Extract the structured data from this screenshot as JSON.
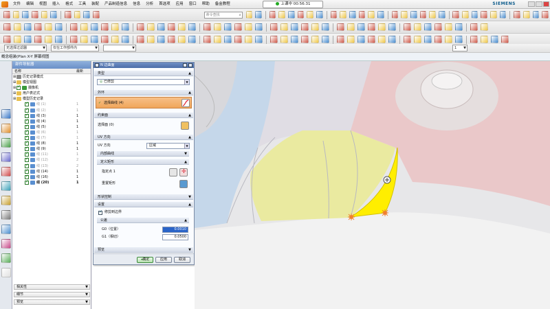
{
  "menu_bar": {
    "items": [
      "文件",
      "编辑",
      "视图",
      "插入",
      "格式",
      "工具",
      "装配",
      "产品制造信息",
      "信息",
      "分析",
      "首选项",
      "应用",
      "窗口",
      "帮助",
      "备金教程"
    ],
    "recording": "上课中 00:56:31",
    "brand": "SIEMENS"
  },
  "toolbar": {
    "command_search_placeholder": "命令查找",
    "filter_value": "无选择过滤器",
    "assembly_scope": "仅在工作部件内",
    "layer_value": "1"
  },
  "view_title": "概念组装(Plan X-Y 屏幕视图",
  "navigator": {
    "title": "部件导航器",
    "col_name": "名称",
    "col_update": "最新",
    "rows": [
      {
        "label": "历史记录模式",
        "val": "",
        "icon": "history",
        "indent": 0,
        "checked": false,
        "style": ""
      },
      {
        "label": "模型视图",
        "val": "",
        "icon": "folder",
        "indent": 0,
        "checked": false,
        "style": ""
      },
      {
        "label": "摄像机",
        "val": "",
        "icon": "camera",
        "indent": 0,
        "checked": true,
        "style": ""
      },
      {
        "label": "用户表达式",
        "val": "",
        "icon": "folder",
        "indent": 0,
        "checked": false,
        "style": ""
      },
      {
        "label": "模型历史记录",
        "val": "",
        "icon": "folder",
        "indent": 0,
        "checked": false,
        "style": ""
      },
      {
        "label": "线 (1)",
        "val": "1",
        "icon": "feature",
        "indent": 1,
        "checked": true,
        "style": "gray"
      },
      {
        "label": "线 (2)",
        "val": "1",
        "icon": "feature",
        "indent": 1,
        "checked": true,
        "style": "gray"
      },
      {
        "label": "线 (3)",
        "val": "1",
        "icon": "feature",
        "indent": 1,
        "checked": true,
        "style": ""
      },
      {
        "label": "线 (4)",
        "val": "1",
        "icon": "feature",
        "indent": 1,
        "checked": true,
        "style": ""
      },
      {
        "label": "线 (5)",
        "val": "1",
        "icon": "feature",
        "indent": 1,
        "checked": true,
        "style": ""
      },
      {
        "label": "线 (6)",
        "val": "1",
        "icon": "feature",
        "indent": 1,
        "checked": true,
        "style": "gray"
      },
      {
        "label": "线 (7)",
        "val": "1",
        "icon": "feature",
        "indent": 1,
        "checked": true,
        "style": "gray"
      },
      {
        "label": "线 (8)",
        "val": "1",
        "icon": "feature",
        "indent": 1,
        "checked": true,
        "style": ""
      },
      {
        "label": "线 (9)",
        "val": "1",
        "icon": "feature",
        "indent": 1,
        "checked": true,
        "style": ""
      },
      {
        "label": "线 (11)",
        "val": "1",
        "icon": "feature",
        "indent": 1,
        "checked": true,
        "style": "gray"
      },
      {
        "label": "线 (12)",
        "val": "2",
        "icon": "feature",
        "indent": 1,
        "checked": true,
        "style": "gray"
      },
      {
        "label": "线 (13)",
        "val": "2",
        "icon": "feature",
        "indent": 1,
        "checked": true,
        "style": "gray"
      },
      {
        "label": "线 (14)",
        "val": "1",
        "icon": "feature",
        "indent": 1,
        "checked": true,
        "style": ""
      },
      {
        "label": "线 (16)",
        "val": "1",
        "icon": "feature",
        "indent": 1,
        "checked": true,
        "style": ""
      },
      {
        "label": "线 (20)",
        "val": "1",
        "icon": "feature",
        "indent": 1,
        "checked": true,
        "style": "bold"
      }
    ],
    "accordions": [
      "相关性",
      "细节",
      "预览"
    ]
  },
  "dialog": {
    "title": "N 边曲面",
    "type_section": "类型",
    "type_value": "已修剪",
    "outer_ring_section": "外环",
    "select_curve": "选择曲线 (4)",
    "constraint_section": "约束面",
    "select_face": "选择面 (0)",
    "uv_section": "UV 方向",
    "uv_dir_label": "UV 方向",
    "uv_dir_value": "区域",
    "inner_curve": "内部曲线",
    "define_rect": "定义矩形",
    "spec_point": "指定点 1",
    "reset_rect": "重置矩形",
    "shape_control": "形状控制",
    "settings_section": "设置",
    "trim_boundary": "修剪到边界",
    "tolerance_section": "公差",
    "g0_label": "G0（位置）",
    "g0_value": "0.0010",
    "g1_label": "G1（相切）",
    "g1_value": "0.0500",
    "preview_section": "预览",
    "ok_label": "确定",
    "apply_label": "应用",
    "cancel_label": "取消"
  }
}
